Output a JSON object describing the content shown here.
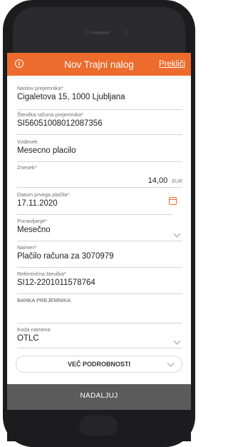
{
  "header": {
    "title": "Nov Trajni nalog",
    "cancel_label": "Prekliči"
  },
  "fields": {
    "address": {
      "label": "Naslov prejemnika*",
      "value": "Cigaletova 15, 1000 Ljubljana"
    },
    "account": {
      "label": "Številka računa prejemnika*",
      "value": "SI56051008012087356"
    },
    "reason": {
      "label": "Vzdevek",
      "value": "Mesecno placilo"
    },
    "amount": {
      "label": "Znesek*",
      "value": "14,00",
      "currency": "EUR"
    },
    "first_payment": {
      "label": "Datum prvega plačila*",
      "value": "17.11.2020"
    },
    "repeat": {
      "label": "Ponavljanje*",
      "value": "Mesečno"
    },
    "purpose": {
      "label": "Namen*",
      "value": "Plačilo računa za 3070979"
    },
    "reference": {
      "label": "Referenčna številka*",
      "value": "SI12-2201011578764"
    },
    "bank": {
      "label": "BANKA PREJEMNIKA",
      "value": ""
    },
    "code": {
      "label": "Koda namena",
      "value": "OTLC"
    }
  },
  "more_button_label": "VEČ PODROBNOSTI",
  "footer_button_label": "NADALJUJ",
  "colors": {
    "accent": "#ec6b2d",
    "footer": "#5b5b5b"
  }
}
